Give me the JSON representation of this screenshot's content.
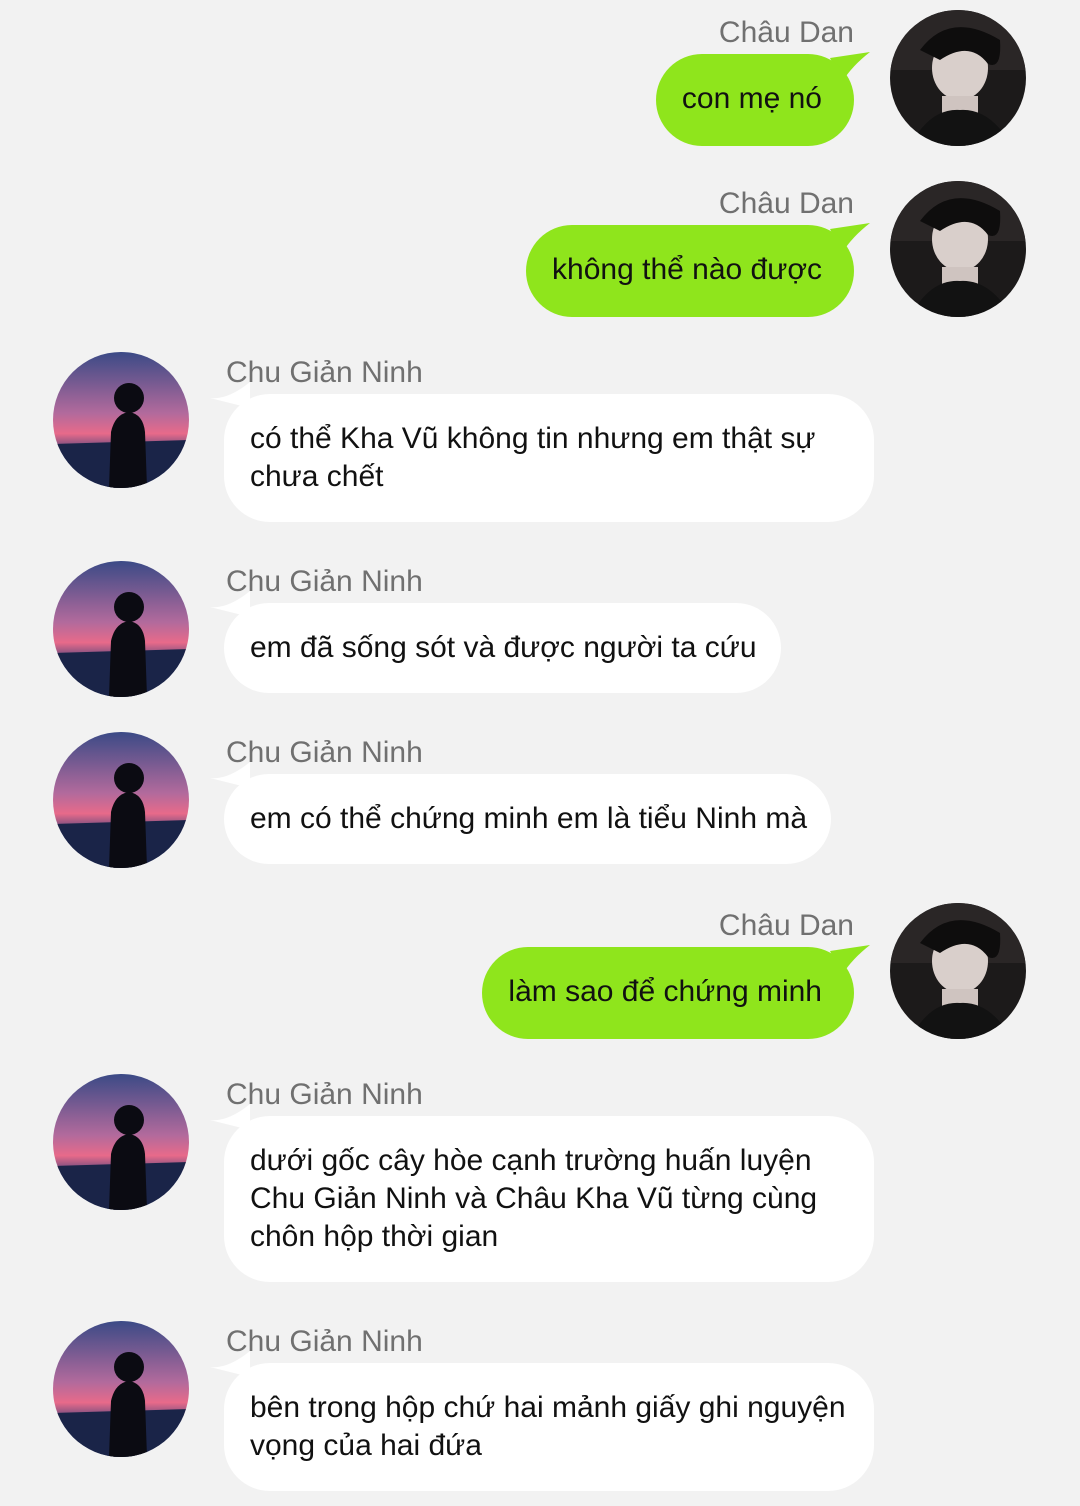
{
  "colors": {
    "background": "#f2f2f2",
    "outgoing_bubble": "#8fe51c",
    "incoming_bubble": "#ffffff",
    "name_text": "#707070"
  },
  "messages": [
    {
      "side": "right",
      "sender": "Châu Dan",
      "text": "con mẹ nó",
      "avatar": "avatar-chau-dan"
    },
    {
      "side": "right",
      "sender": "Châu Dan",
      "text": "không thể nào được",
      "avatar": "avatar-chau-dan"
    },
    {
      "side": "left",
      "sender": "Chu Giản Ninh",
      "text": "có thể Kha Vũ không tin nhưng em thật sự chưa chết",
      "avatar": "avatar-chu-gian-ninh"
    },
    {
      "side": "left",
      "sender": "Chu Giản Ninh",
      "text": "em đã sống sót và được người ta cứu",
      "avatar": "avatar-chu-gian-ninh"
    },
    {
      "side": "left",
      "sender": "Chu Giản Ninh",
      "text": "em có thể chứng minh em là tiểu Ninh mà",
      "avatar": "avatar-chu-gian-ninh"
    },
    {
      "side": "right",
      "sender": "Châu Dan",
      "text": "làm sao để chứng minh",
      "avatar": "avatar-chau-dan"
    },
    {
      "side": "left",
      "sender": "Chu Giản Ninh",
      "text": "dưới gốc cây hòe cạnh trường huấn luyện Chu Giản Ninh và Châu Kha Vũ từng cùng chôn hộp thời gian",
      "avatar": "avatar-chu-gian-ninh"
    },
    {
      "side": "left",
      "sender": "Chu Giản Ninh",
      "text": "bên trong hộp chứ hai mảnh giấy ghi nguyện vọng của hai đứa",
      "avatar": "avatar-chu-gian-ninh"
    }
  ]
}
